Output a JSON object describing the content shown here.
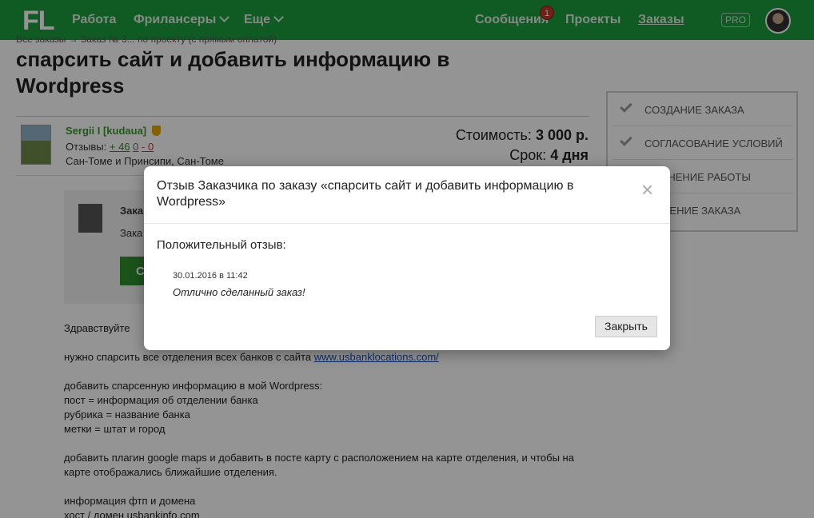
{
  "topnav": {
    "logo": "FL",
    "items": [
      "Работа",
      "Фрилансеры",
      "Еще"
    ],
    "messages": "Сообщения",
    "messages_badge": "1",
    "projects": "Проекты",
    "orders": "Заказы",
    "pro": "PRO"
  },
  "page": {
    "breadcrumb": "Все заказы → Заказ № 3... по проекту (с прямым оплатой)",
    "title": "спарсить сайт и добавить информацию в Wordpress",
    "freelancer": {
      "name": "Sergii I [kudaua]",
      "reviews_label": "Отзывы:",
      "reviews_plus": "+ 46",
      "reviews_zero": "0",
      "reviews_minus": "- 0",
      "location": "Сан-Томе и Принсипи, Сан-Томе"
    },
    "cost_label": "Стоимость:",
    "cost_value": "3 000 р.",
    "term_label": "Срок:",
    "term_value": "4 дня",
    "status_title": "Зака",
    "status_sub": "Зака",
    "status_button": "С",
    "description": [
      "Здравствуйте",
      "",
      "нужно спарсить все отделения всех банков с сайта ",
      "",
      "добавить спарсенную информацию в мой Wordpress:",
      "пост = информация об отделении банка",
      "рубрика = название банка",
      "метки = штат  и город",
      "",
      "добавить плагин google maps и добавить в посте карту с расположением на карте отделения, и чтобы на",
      "карте отображались ближайшие отделения.",
      "",
      "информация фтп и домена",
      "хост / домен usbankinfo.com"
    ],
    "description_link": "www.usbanklocations.com/"
  },
  "steps": [
    "Создание заказа",
    "Согласование условий",
    "...олнение работы",
    "...ршение заказа"
  ],
  "modal": {
    "title": "Отзыв Заказчика по заказу «спарсить сайт и добавить информацию в Wordpress»",
    "review_label": "Положительный отзыв:",
    "review_date": "30.01.2016 в 11:42",
    "review_text": "Отлично сделанный заказ!",
    "close_button": "Закрыть"
  }
}
